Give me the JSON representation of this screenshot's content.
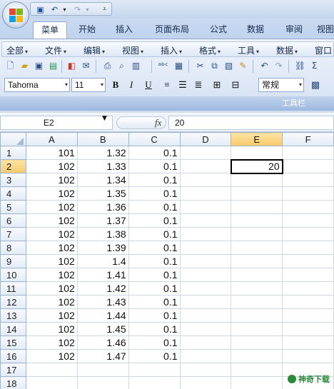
{
  "title_bar": {
    "quick_access": [
      "save-icon",
      "undo-icon",
      "redo-icon",
      "customize-icon"
    ]
  },
  "ribbon_tabs": [
    {
      "label": "菜单",
      "active": true
    },
    {
      "label": "开始",
      "active": false
    },
    {
      "label": "插入",
      "active": false
    },
    {
      "label": "页面布局",
      "active": false
    },
    {
      "label": "公式",
      "active": false
    },
    {
      "label": "数据",
      "active": false
    },
    {
      "label": "审阅",
      "active": false
    },
    {
      "label": "视图",
      "active": false
    }
  ],
  "menu_bar": [
    {
      "label": "全部"
    },
    {
      "label": "文件"
    },
    {
      "label": "编辑"
    },
    {
      "label": "视图"
    },
    {
      "label": "插入"
    },
    {
      "label": "格式"
    },
    {
      "label": "工具"
    },
    {
      "label": "数据"
    },
    {
      "label": "窗口"
    }
  ],
  "toolbar": {
    "font_name": "Tahoma",
    "font_size": "11",
    "bold": "B",
    "italic": "I",
    "underline": "U",
    "number_format": "常规",
    "group_label": "工具栏"
  },
  "formula_bar": {
    "name_box": "E2",
    "fx_label": "fx",
    "formula_value": "20"
  },
  "sheet": {
    "columns": [
      "A",
      "B",
      "C",
      "D",
      "E",
      "F"
    ],
    "selected_column": "E",
    "selected_row": "2",
    "rows": [
      {
        "row": "1",
        "A": "101",
        "B": "1.32",
        "C": "0.1",
        "D": "",
        "E": "",
        "F": ""
      },
      {
        "row": "2",
        "A": "102",
        "B": "1.33",
        "C": "0.1",
        "D": "",
        "E": "20",
        "F": ""
      },
      {
        "row": "3",
        "A": "102",
        "B": "1.34",
        "C": "0.1",
        "D": "",
        "E": "",
        "F": ""
      },
      {
        "row": "4",
        "A": "102",
        "B": "1.35",
        "C": "0.1",
        "D": "",
        "E": "",
        "F": ""
      },
      {
        "row": "5",
        "A": "102",
        "B": "1.36",
        "C": "0.1",
        "D": "",
        "E": "",
        "F": ""
      },
      {
        "row": "6",
        "A": "102",
        "B": "1.37",
        "C": "0.1",
        "D": "",
        "E": "",
        "F": ""
      },
      {
        "row": "7",
        "A": "102",
        "B": "1.38",
        "C": "0.1",
        "D": "",
        "E": "",
        "F": ""
      },
      {
        "row": "8",
        "A": "102",
        "B": "1.39",
        "C": "0.1",
        "D": "",
        "E": "",
        "F": ""
      },
      {
        "row": "9",
        "A": "102",
        "B": "1.4",
        "C": "0.1",
        "D": "",
        "E": "",
        "F": ""
      },
      {
        "row": "10",
        "A": "102",
        "B": "1.41",
        "C": "0.1",
        "D": "",
        "E": "",
        "F": ""
      },
      {
        "row": "11",
        "A": "102",
        "B": "1.42",
        "C": "0.1",
        "D": "",
        "E": "",
        "F": ""
      },
      {
        "row": "12",
        "A": "102",
        "B": "1.43",
        "C": "0.1",
        "D": "",
        "E": "",
        "F": ""
      },
      {
        "row": "13",
        "A": "102",
        "B": "1.44",
        "C": "0.1",
        "D": "",
        "E": "",
        "F": ""
      },
      {
        "row": "14",
        "A": "102",
        "B": "1.45",
        "C": "0.1",
        "D": "",
        "E": "",
        "F": ""
      },
      {
        "row": "15",
        "A": "102",
        "B": "1.46",
        "C": "0.1",
        "D": "",
        "E": "",
        "F": ""
      },
      {
        "row": "16",
        "A": "102",
        "B": "1.47",
        "C": "0.1",
        "D": "",
        "E": "",
        "F": ""
      },
      {
        "row": "17",
        "A": "",
        "B": "",
        "C": "",
        "D": "",
        "E": "",
        "F": ""
      },
      {
        "row": "18",
        "A": "",
        "B": "",
        "C": "",
        "D": "",
        "E": "",
        "F": ""
      }
    ]
  },
  "watermark": "神奇下载",
  "colors": {
    "selected_header": "#f7c96a",
    "gridline": "#d0d7e5",
    "ribbon": "#dbe6f5"
  }
}
